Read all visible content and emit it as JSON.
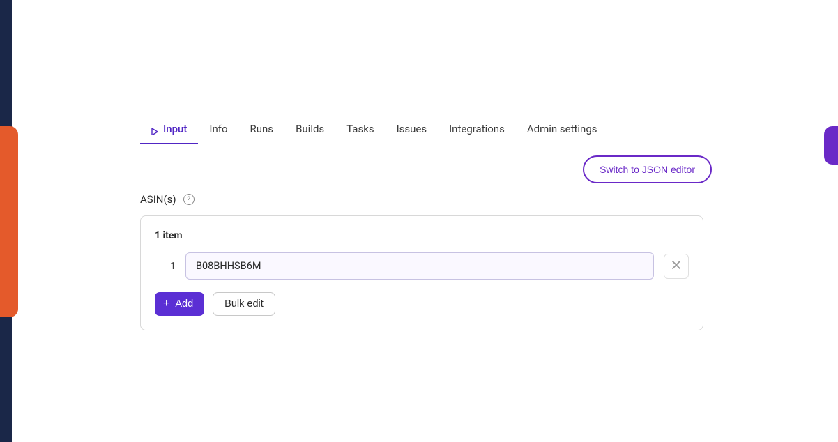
{
  "tabs": [
    {
      "label": "Input",
      "active": true
    },
    {
      "label": "Info"
    },
    {
      "label": "Runs"
    },
    {
      "label": "Builds"
    },
    {
      "label": "Tasks"
    },
    {
      "label": "Issues"
    },
    {
      "label": "Integrations"
    },
    {
      "label": "Admin settings"
    }
  ],
  "toolbar": {
    "switch_json_label": "Switch to JSON editor"
  },
  "field": {
    "label": "ASIN(s)",
    "items_count": "1 item",
    "items": [
      {
        "number": "1",
        "value": "B08BHHSB6M"
      }
    ],
    "add_label": "Add",
    "bulk_label": "Bulk edit"
  }
}
